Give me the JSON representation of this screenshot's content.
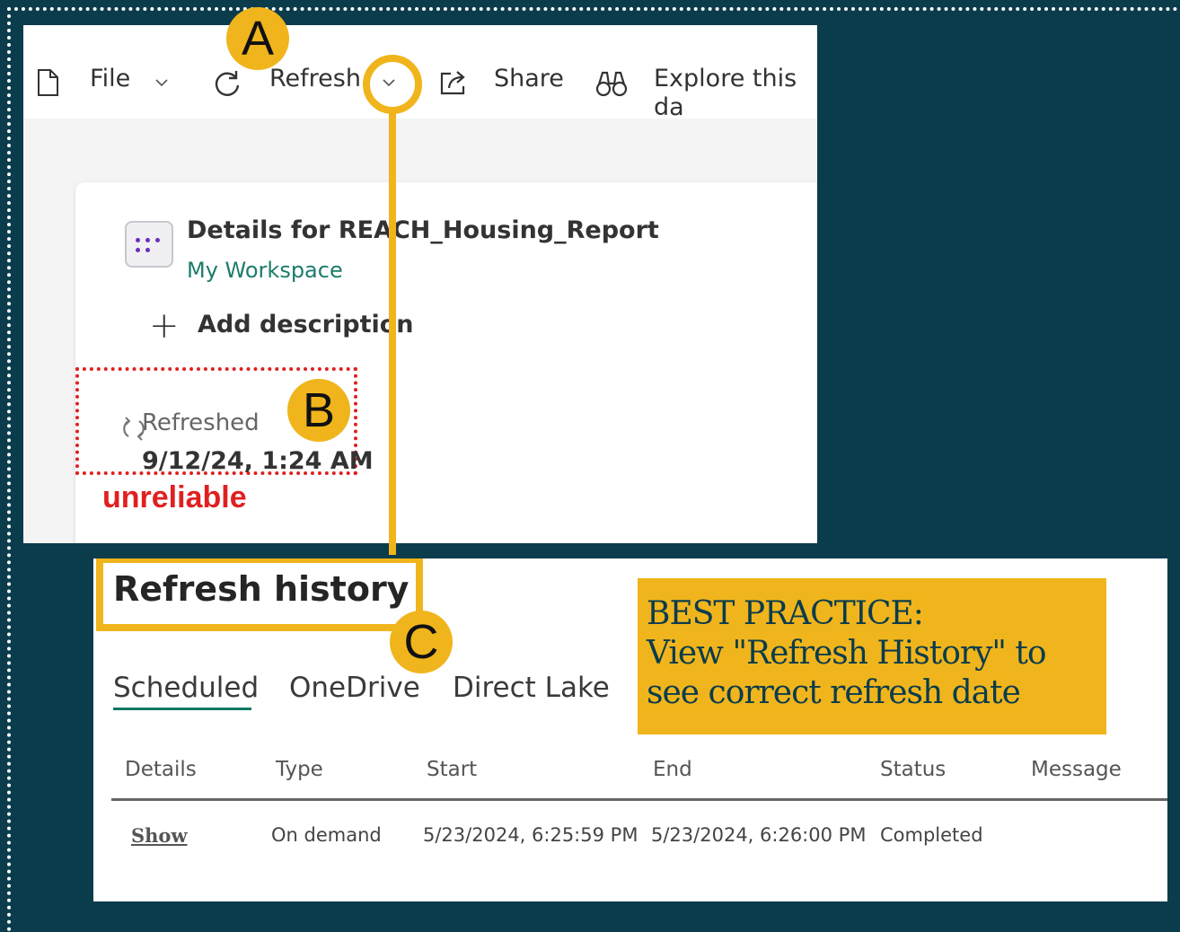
{
  "toolbar": {
    "file_label": "File",
    "refresh_label": "Refresh",
    "share_label": "Share",
    "explore_label": "Explore this da"
  },
  "details": {
    "title": "Details for REACH_Housing_Report",
    "workspace": "My Workspace",
    "add_description": "Add description",
    "refreshed_label": "Refreshed",
    "refreshed_date": "9/12/24, 1:24 AM",
    "warning": "unreliable"
  },
  "refresh_history": {
    "title": "Refresh history",
    "tabs": [
      "Scheduled",
      "OneDrive",
      "Direct Lake"
    ],
    "columns": [
      "Details",
      "Type",
      "Start",
      "End",
      "Status",
      "Message"
    ],
    "rows": [
      {
        "details": "Show",
        "type": "On demand",
        "start": "5/23/2024, 6:25:59 PM",
        "end": "5/23/2024, 6:26:00 PM",
        "status": "Completed",
        "message": ""
      }
    ]
  },
  "callout": {
    "line1": "BEST PRACTICE:",
    "line2": "View \"Refresh History\" to",
    "line3": "see correct refresh date"
  },
  "badges": {
    "a": "A",
    "b": "B",
    "c": "C"
  },
  "colors": {
    "accent": "#f0b51c",
    "background": "#0b3c4c",
    "warning": "#e02020",
    "link": "#1c7c6b"
  }
}
